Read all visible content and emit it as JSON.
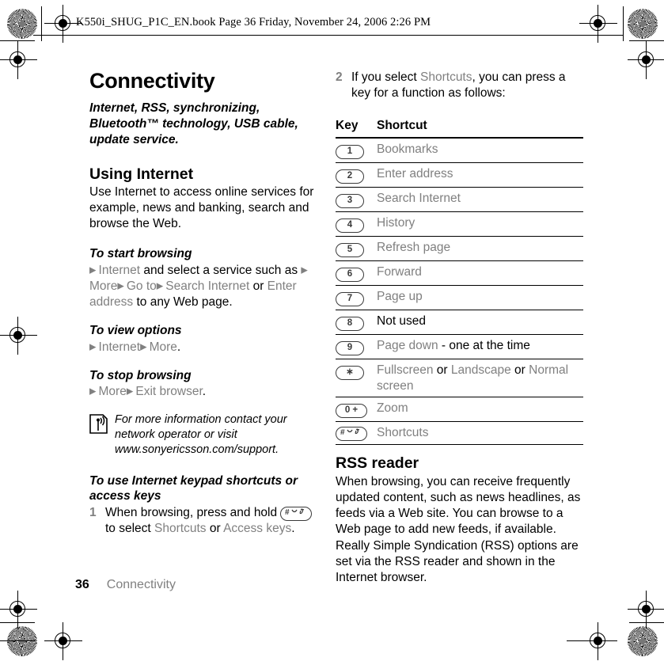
{
  "header": {
    "text": "K550i_SHUG_P1C_EN.book  Page 36  Friday, November 24, 2006  2:26 PM"
  },
  "left_column": {
    "chapter_title": "Connectivity",
    "chapter_intro": "Internet, RSS, synchronizing, Bluetooth™ technology, USB cable, update service.",
    "section_title": "Using Internet",
    "section_body": "Use Internet to access online services for example, news and banking, search and browse the Web.",
    "procedures": [
      {
        "heading": "To start browsing",
        "parts": [
          {
            "type": "arrow",
            "text": "▶"
          },
          {
            "type": "ui",
            "text": "Internet"
          },
          {
            "type": "plain",
            "text": " and select a service such as "
          },
          {
            "type": "arrow",
            "text": "▶"
          },
          {
            "type": "ui",
            "text": "More"
          },
          {
            "type": "arrow",
            "text": "▶"
          },
          {
            "type": "ui",
            "text": "Go to"
          },
          {
            "type": "arrow",
            "text": "▶"
          },
          {
            "type": "ui",
            "text": "Search Internet"
          },
          {
            "type": "plain",
            "text": " or "
          },
          {
            "type": "ui",
            "text": "Enter address"
          },
          {
            "type": "plain",
            "text": " to any Web page."
          }
        ]
      },
      {
        "heading": "To view options",
        "parts": [
          {
            "type": "arrow",
            "text": "▶"
          },
          {
            "type": "ui",
            "text": "Internet"
          },
          {
            "type": "arrow",
            "text": "▶"
          },
          {
            "type": "ui",
            "text": "More"
          },
          {
            "type": "plain",
            "text": "."
          }
        ]
      },
      {
        "heading": "To stop browsing",
        "parts": [
          {
            "type": "arrow",
            "text": "▶"
          },
          {
            "type": "ui",
            "text": "More"
          },
          {
            "type": "arrow",
            "text": "▶"
          },
          {
            "type": "ui",
            "text": "Exit browser"
          },
          {
            "type": "plain",
            "text": "."
          }
        ]
      }
    ],
    "note": {
      "icon": "signal-antenna-icon",
      "text": "For more information contact your network operator or visit www.sonyericsson.com/support."
    },
    "keypad_procedure": {
      "heading": "To use Internet keypad shortcuts or access keys",
      "step_number": "1",
      "step_text_before": "When browsing, press and hold ",
      "step_key": "#⏒♪",
      "step_text_after_1": "to select ",
      "step_ui_1": "Shortcuts",
      "step_text_or": " or ",
      "step_ui_2": "Access keys",
      "step_text_end": "."
    }
  },
  "right_column": {
    "intro_step": {
      "number": "2",
      "text_before": "If you select ",
      "ui_term": "Shortcuts",
      "text_after": ", you can press a key for a function as follows:"
    },
    "table": {
      "headers": [
        "Key",
        "Shortcut"
      ],
      "rows": [
        {
          "key": "1",
          "key_type": "digit",
          "parts": [
            {
              "type": "ui",
              "text": "Bookmarks"
            }
          ]
        },
        {
          "key": "2",
          "key_type": "digit",
          "parts": [
            {
              "type": "ui",
              "text": "Enter address"
            }
          ]
        },
        {
          "key": "3",
          "key_type": "digit",
          "parts": [
            {
              "type": "ui",
              "text": "Search Internet"
            }
          ]
        },
        {
          "key": "4",
          "key_type": "digit",
          "parts": [
            {
              "type": "ui",
              "text": "History"
            }
          ]
        },
        {
          "key": "5",
          "key_type": "digit",
          "parts": [
            {
              "type": "ui",
              "text": "Refresh page"
            }
          ]
        },
        {
          "key": "6",
          "key_type": "digit",
          "parts": [
            {
              "type": "ui",
              "text": "Forward"
            }
          ]
        },
        {
          "key": "7",
          "key_type": "digit",
          "parts": [
            {
              "type": "ui",
              "text": "Page up"
            }
          ]
        },
        {
          "key": "8",
          "key_type": "digit",
          "parts": [
            {
              "type": "plain",
              "text": "Not used"
            }
          ]
        },
        {
          "key": "9",
          "key_type": "digit",
          "parts": [
            {
              "type": "ui",
              "text": "Page down"
            },
            {
              "type": "plain",
              "text": " - one at the time"
            }
          ]
        },
        {
          "key": "✳",
          "key_type": "star",
          "parts": [
            {
              "type": "ui",
              "text": "Fullscreen"
            },
            {
              "type": "plain",
              "text": " or "
            },
            {
              "type": "ui",
              "text": "Landscape"
            },
            {
              "type": "plain",
              "text": " or "
            },
            {
              "type": "ui",
              "text": "Normal screen"
            }
          ]
        },
        {
          "key": "0 +",
          "key_type": "zero",
          "parts": [
            {
              "type": "ui",
              "text": "Zoom"
            }
          ]
        },
        {
          "key": "#⏒♪",
          "key_type": "hash",
          "parts": [
            {
              "type": "ui",
              "text": "Shortcuts"
            }
          ]
        }
      ]
    },
    "rss": {
      "heading": "RSS reader",
      "body": "When browsing, you can receive frequently updated content, such as news headlines, as feeds via a Web site. You can browse to a Web page to add new feeds, if available. Really Simple Syndication (RSS) options are set via the RSS reader and shown in the Internet browser."
    }
  },
  "footer": {
    "page_number": "36",
    "chapter_name": "Connectivity"
  },
  "colors": {
    "ui_term_gray": "#808080",
    "text_black": "#000000",
    "key_outline": "#3a3a3a"
  }
}
